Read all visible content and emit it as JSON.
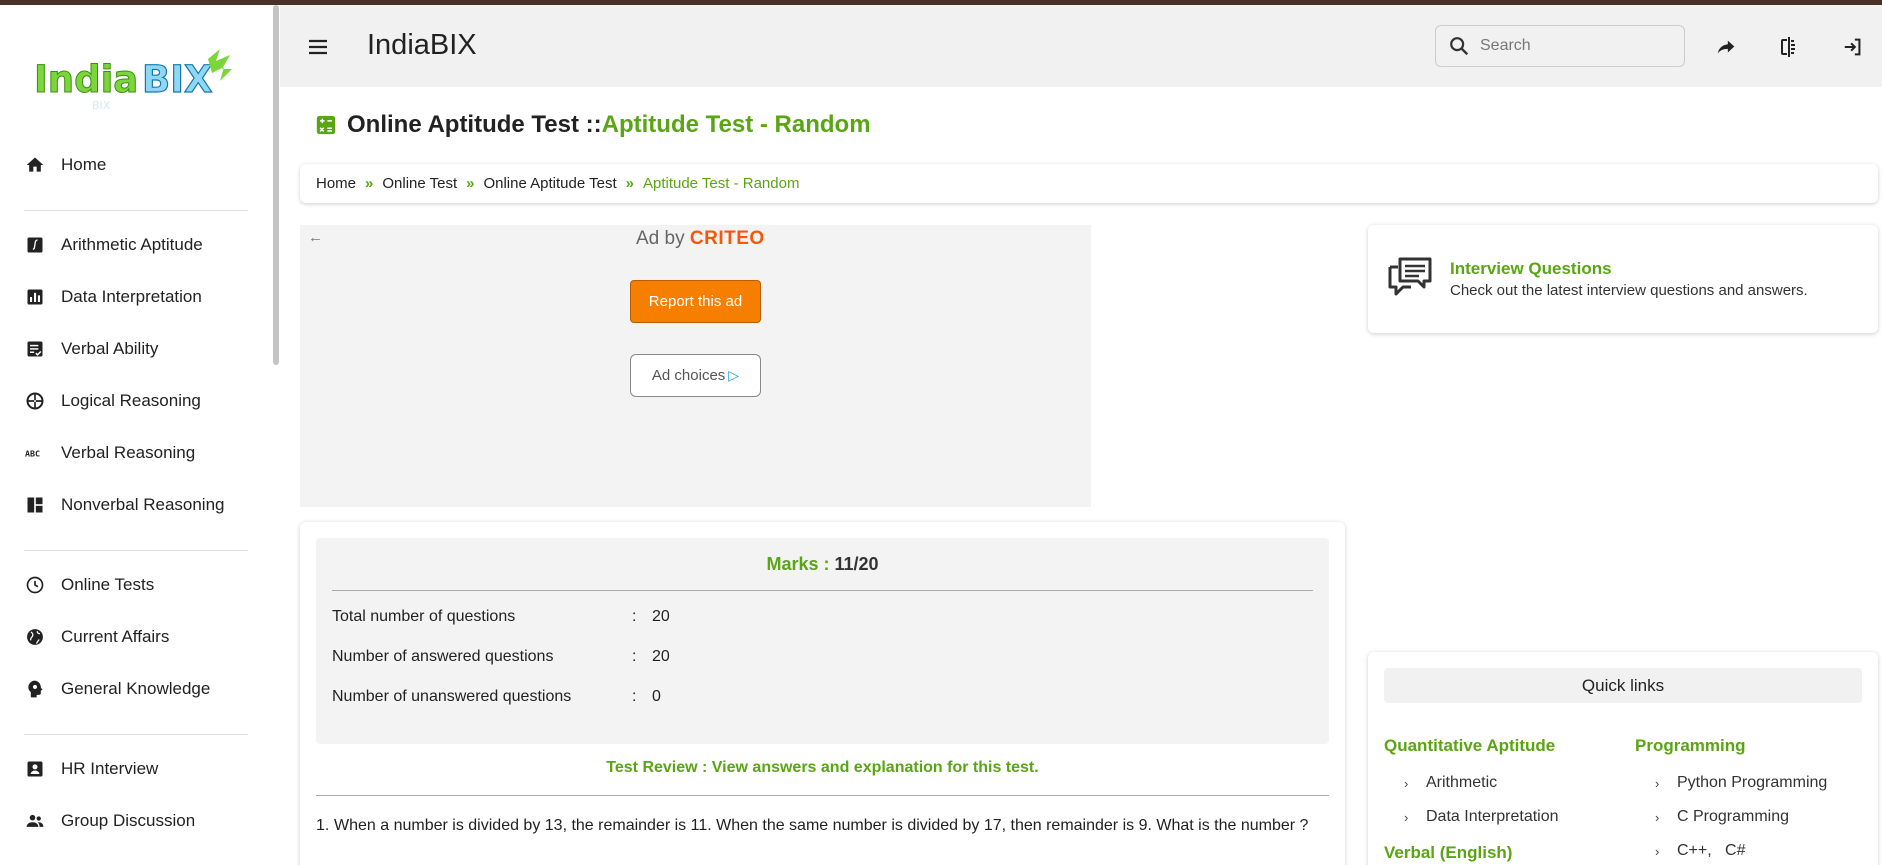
{
  "sidebar": {
    "logo_text": "IndiaBIX",
    "items": [
      {
        "label": "Home",
        "icon": "home-icon"
      },
      {
        "label": "Arithmetic Aptitude",
        "icon": "integral-icon"
      },
      {
        "label": "Data Interpretation",
        "icon": "bar-chart-icon"
      },
      {
        "label": "Verbal Ability",
        "icon": "checklist-icon"
      },
      {
        "label": "Logical Reasoning",
        "icon": "aperture-icon"
      },
      {
        "label": "Verbal Reasoning",
        "icon": "abc-icon"
      },
      {
        "label": "Nonverbal Reasoning",
        "icon": "dashboard-icon"
      },
      {
        "label": "Online Tests",
        "icon": "clock-icon"
      },
      {
        "label": "Current Affairs",
        "icon": "globe-icon"
      },
      {
        "label": "General Knowledge",
        "icon": "bulb-head-icon"
      },
      {
        "label": "HR Interview",
        "icon": "badge-icon"
      },
      {
        "label": "Group Discussion",
        "icon": "group-icon"
      }
    ]
  },
  "header": {
    "brand": "IndiaBIX",
    "search_placeholder": "Search"
  },
  "page": {
    "title_prefix": "Online Aptitude Test :: ",
    "title_highlight": "Aptitude Test - Random"
  },
  "breadcrumb": {
    "items": [
      "Home",
      "Online Test",
      "Online Aptitude Test"
    ],
    "current": "Aptitude Test - Random",
    "separator": "»"
  },
  "ad": {
    "back_arrow": "←",
    "by_label": "Ad by",
    "by_brand": "CRITEO",
    "report_label": "Report this ad",
    "choices_label": "Ad choices",
    "choices_glyph": "▷"
  },
  "results": {
    "marks_label": "Marks : ",
    "marks_value": "11/20",
    "colon": ":",
    "stats": [
      {
        "label": "Total number of questions",
        "value": "20"
      },
      {
        "label": "Number of answered questions",
        "value": "20"
      },
      {
        "label": "Number of unanswered questions",
        "value": "0"
      }
    ],
    "review_link": "Test Review : View answers and explanation for this test.",
    "question_number": "1.",
    "question_text": "When a number is divided by 13, the remainder is 11. When the same number is divided by 17, then remainder is 9. What is the number ?"
  },
  "interview": {
    "title": "Interview Questions",
    "description": "Check out the latest interview questions and answers."
  },
  "quick_links": {
    "title": "Quick links",
    "chevron": "›",
    "quant_title": "Quantitative Aptitude",
    "quant_links": [
      "Arithmetic",
      "Data Interpretation"
    ],
    "verbal_title": "Verbal (English)",
    "prog_title": "Programming",
    "prog_links": [
      "Python Programming",
      "C Programming",
      "C++,   C#"
    ]
  },
  "colors": {
    "accent_green": "#5aa514",
    "ad_orange": "#f77f00",
    "criteo_orange": "#f4580a",
    "top_strip": "#4a3128"
  }
}
